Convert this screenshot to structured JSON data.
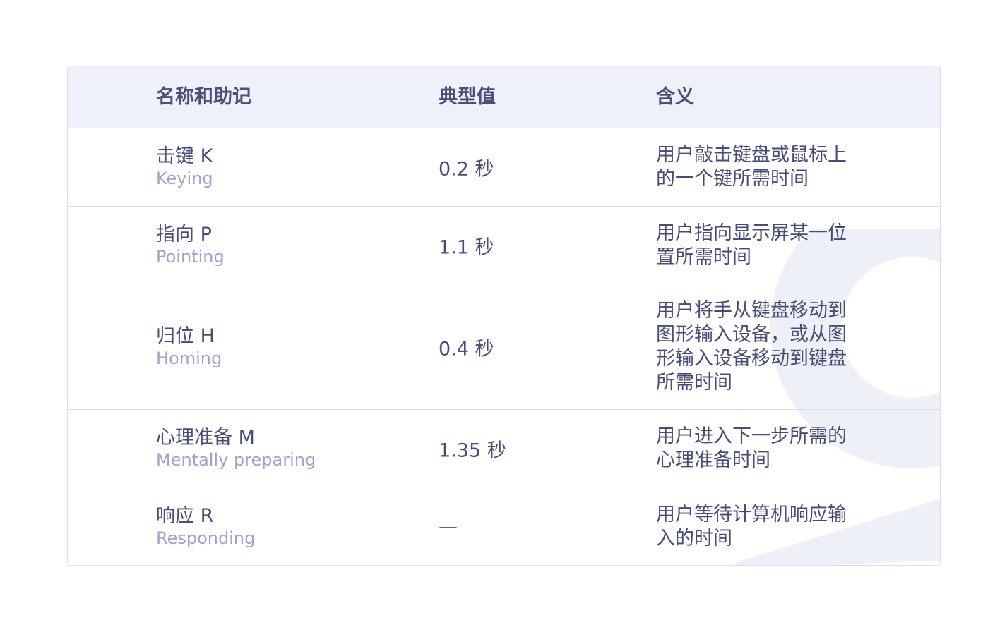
{
  "table": {
    "headers": {
      "name": "名称和助记",
      "value": "典型值",
      "meaning": "含义"
    },
    "rows": [
      {
        "name_cn": "击键 K",
        "name_en": "Keying",
        "value": "0.2 秒",
        "meaning": "用户敲击键盘或鼠标上的一个键所需时间"
      },
      {
        "name_cn": "指向 P",
        "name_en": "Pointing",
        "value": "1.1 秒",
        "meaning": "用户指向显示屏某一位置所需时间"
      },
      {
        "name_cn": "归位 H",
        "name_en": "Homing",
        "value": "0.4 秒",
        "meaning": "用户将手从键盘移动到图形输入设备，或从图形输入设备移动到键盘所需时间"
      },
      {
        "name_cn": "心理准备 M",
        "name_en": "Mentally preparing",
        "value": "1.35 秒",
        "meaning": "用户进入下一步所需的心理准备时间"
      },
      {
        "name_cn": "响应 R",
        "name_en": "Responding",
        "value": "—",
        "meaning": "用户等待计算机响应输入的时间"
      }
    ]
  },
  "colors": {
    "header_bg": "#eef1f9",
    "text_primary": "#474c78",
    "text_secondary": "#9ea3cc",
    "border": "#dcdde6"
  }
}
